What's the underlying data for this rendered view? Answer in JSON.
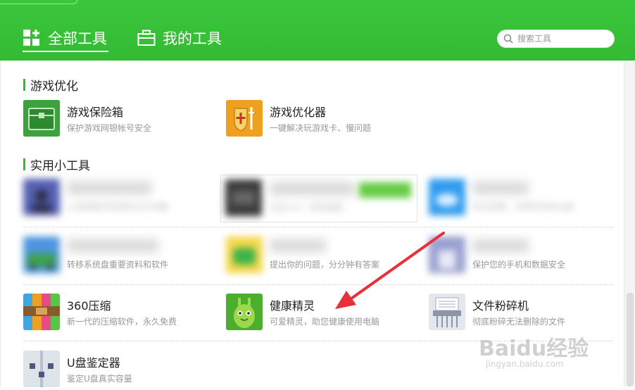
{
  "header": {
    "tab_all": "全部工具",
    "tab_mine": "我的工具",
    "search_placeholder": "搜索工具"
  },
  "sections": {
    "game": {
      "title": "游戏优化"
    },
    "utility": {
      "title": "实用小工具"
    }
  },
  "tools": {
    "game_vault": {
      "name": "游戏保险箱",
      "desc": "保护游戏网银帐号安全"
    },
    "game_optimizer": {
      "name": "游戏优化器",
      "desc": "一键解决玩游戏卡、慢问题"
    },
    "u1": {
      "name": "",
      "desc": "让视频聊天防窥安全又有趣"
    },
    "u2": {
      "name": "",
      "desc": "双击ctrl，即刻搜索"
    },
    "u3": {
      "name": "",
      "desc": "安全免费，无限空间的云盘"
    },
    "u4": {
      "name": "",
      "desc": "转移系统盘重要资料和软件"
    },
    "u5": {
      "name": "",
      "desc": "提出你的问题，分分钟有答案"
    },
    "u6": {
      "name": "",
      "desc": "保护您的手机和数据安全"
    },
    "zip360": {
      "name": "360压缩",
      "desc": "新一代的压缩软件，永久免费"
    },
    "health": {
      "name": "健康精灵",
      "desc": "可爱精灵，助您健康使用电脑"
    },
    "shredder": {
      "name": "文件粉碎机",
      "desc": "彻底粉碎无法删除的文件"
    },
    "udisk": {
      "name": "U盘鉴定器",
      "desc": "鉴定U盘真实容量"
    }
  },
  "watermark": {
    "main": "Baidu经验",
    "sub": "jingyan.baidu.com"
  },
  "colors": {
    "header_green": "#33bb33",
    "accent": "#33bb33",
    "arrow": "#e8303a"
  }
}
